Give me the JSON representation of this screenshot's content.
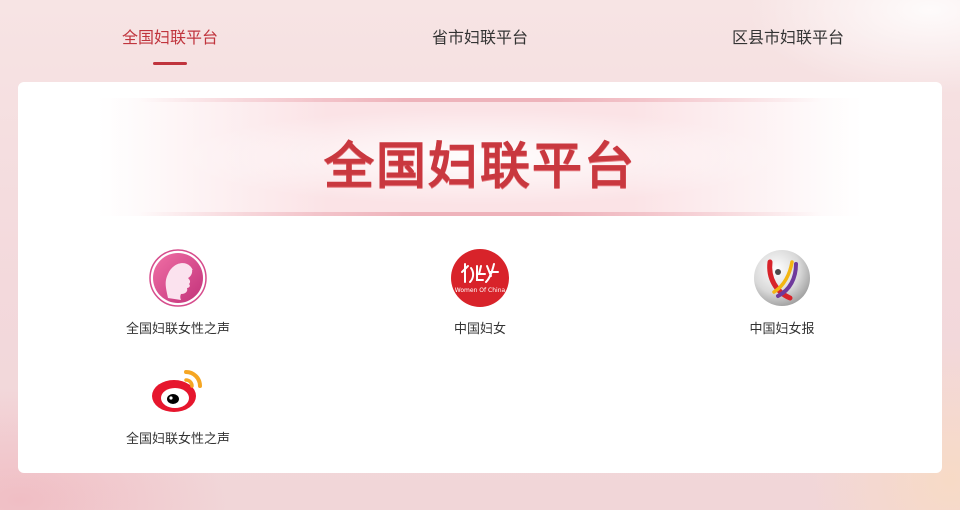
{
  "tabs": [
    {
      "label": "全国妇联平台",
      "active": true
    },
    {
      "label": "省市妇联平台",
      "active": false
    },
    {
      "label": "区县市妇联平台",
      "active": false
    }
  ],
  "banner": {
    "title": "全国妇联平台"
  },
  "platforms": [
    {
      "label": "全国妇联女性之声",
      "icon": "woman-profile-logo-icon"
    },
    {
      "label": "中国妇女",
      "icon": "women-of-china-logo-icon",
      "logo_caption": "Women Of China"
    },
    {
      "label": "中国妇女报",
      "icon": "china-women-news-logo-icon"
    },
    {
      "label": "全国妇联女性之声",
      "icon": "weibo-logo-icon"
    }
  ],
  "colors": {
    "accent": "#c0343d",
    "banner_text": "#c9383f"
  }
}
